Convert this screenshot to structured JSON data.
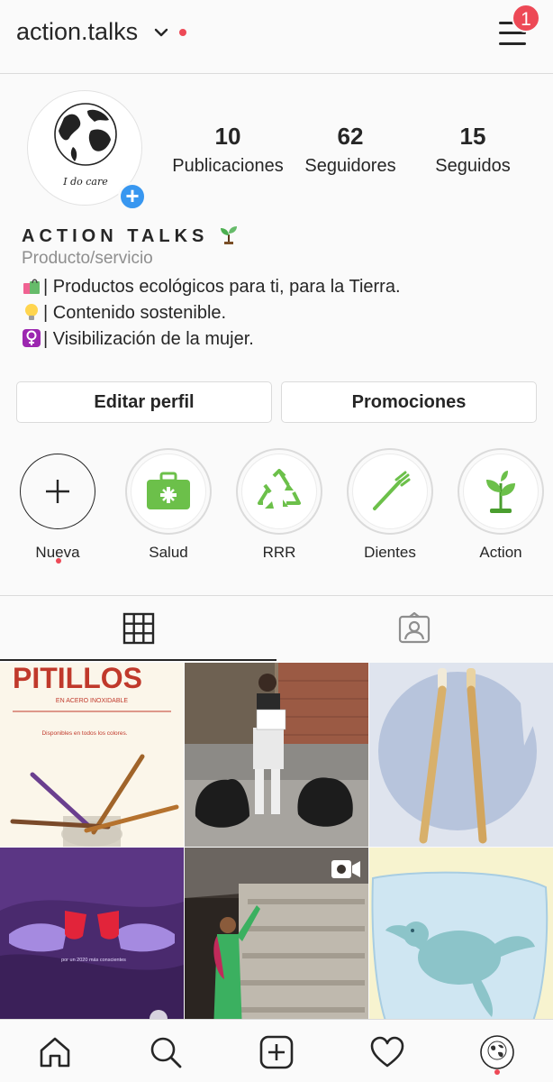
{
  "header": {
    "username": "action.talks",
    "notification_count": "1"
  },
  "profile": {
    "avatar_text": "I do care",
    "stats": [
      {
        "value": "10",
        "label": "Publicaciones"
      },
      {
        "value": "62",
        "label": "Seguidores"
      },
      {
        "value": "15",
        "label": "Seguidos"
      }
    ],
    "display_name": "ACTION TALKS",
    "category": "Producto/servicio",
    "bio": [
      "| Productos ecológicos para ti, para la Tierra.",
      "| Contenido sostenible.",
      "| Visibilización de la mujer."
    ]
  },
  "buttons": {
    "edit": "Editar perfil",
    "promotions": "Promociones"
  },
  "highlights": [
    {
      "label": "Nueva",
      "icon": "plus-icon"
    },
    {
      "label": "Salud",
      "icon": "first-aid-kit-icon"
    },
    {
      "label": "RRR",
      "icon": "recycle-icon"
    },
    {
      "label": "Dientes",
      "icon": "toothbrush-icon"
    },
    {
      "label": "Action",
      "icon": "sprout-icon"
    }
  ],
  "tabs": [
    {
      "name": "grid-icon",
      "active": true
    },
    {
      "name": "tagged-icon",
      "active": false
    }
  ],
  "posts": [
    {
      "title": "PITILLOS",
      "subtitle": "EN ACERO INOXIDABLE",
      "caption": "Disponibles en todos los colores."
    },
    {
      "caption": ""
    },
    {
      "caption": ""
    },
    {
      "caption": "por un 2020 más conscientes"
    },
    {
      "caption": "",
      "badge": "video-icon"
    },
    {
      "caption": ""
    }
  ],
  "bottom_nav": [
    "home-icon",
    "search-icon",
    "new-post-icon",
    "heart-icon",
    "profile-avatar"
  ],
  "colors": {
    "accent_blue": "#3897f0",
    "notification_red": "#ed4956",
    "highlight_green": "#6cc04a"
  }
}
